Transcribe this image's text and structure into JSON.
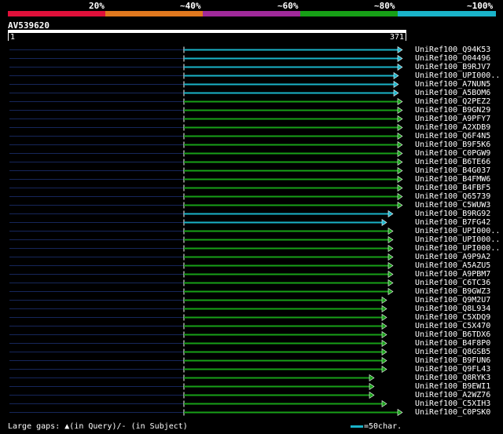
{
  "scale": {
    "labels": [
      "20%",
      "~40%",
      "~60%",
      "~80%",
      "~100%"
    ],
    "colors": [
      "#e0103a",
      "#e0781e",
      "#a02a9a",
      "#17a017",
      "#1ab3c9"
    ]
  },
  "query": {
    "name": "AV539620",
    "start": "1",
    "end": "371"
  },
  "hits": [
    {
      "label": "UniRef100_Q94K53",
      "color": "#1ab3c9",
      "end": 512
    },
    {
      "label": "UniRef100_O04496",
      "color": "#1ab3c9",
      "end": 512
    },
    {
      "label": "UniRef100_B9RJV7",
      "color": "#1ab3c9",
      "end": 512
    },
    {
      "label": "UniRef100_UPI000..",
      "color": "#1ab3c9",
      "end": 507
    },
    {
      "label": "UniRef100_A7NUN5",
      "color": "#1ab3c9",
      "end": 507
    },
    {
      "label": "UniRef100_A5BOM6",
      "color": "#1ab3c9",
      "end": 507
    },
    {
      "label": "UniRef100_Q2PEZ2",
      "color": "#17a017",
      "end": 512
    },
    {
      "label": "UniRef100_B9GN29",
      "color": "#17a017",
      "end": 512
    },
    {
      "label": "UniRef100_A9PFY7",
      "color": "#17a017",
      "end": 512
    },
    {
      "label": "UniRef100_A2XDB9",
      "color": "#17a017",
      "end": 512
    },
    {
      "label": "UniRef100_Q6F4N5",
      "color": "#17a017",
      "end": 512
    },
    {
      "label": "UniRef100_B9F5K6",
      "color": "#17a017",
      "end": 512
    },
    {
      "label": "UniRef100_C0PGW9",
      "color": "#17a017",
      "end": 512
    },
    {
      "label": "UniRef100_B6TE66",
      "color": "#17a017",
      "end": 512
    },
    {
      "label": "UniRef100_B4G037",
      "color": "#17a017",
      "end": 512
    },
    {
      "label": "UniRef100_B4FMW6",
      "color": "#17a017",
      "end": 512
    },
    {
      "label": "UniRef100_B4FBF5",
      "color": "#17a017",
      "end": 512
    },
    {
      "label": "UniRef100_Q65739",
      "color": "#17a017",
      "end": 512
    },
    {
      "label": "UniRef100_C5WUW3",
      "color": "#17a017",
      "end": 512
    },
    {
      "label": "UniRef100_B9RG92",
      "color": "#1ab3c9",
      "end": 500
    },
    {
      "label": "UniRef100_B7FG42",
      "color": "#1ab3c9",
      "end": 492
    },
    {
      "label": "UniRef100_UPI000..",
      "color": "#17a017",
      "end": 500
    },
    {
      "label": "UniRef100_UPI000..",
      "color": "#17a017",
      "end": 500
    },
    {
      "label": "UniRef100_UPI000..",
      "color": "#17a017",
      "end": 500
    },
    {
      "label": "UniRef100_A9P9A2",
      "color": "#17a017",
      "end": 500
    },
    {
      "label": "UniRef100_A5AZU5",
      "color": "#17a017",
      "end": 500
    },
    {
      "label": "UniRef100_A9PBM7",
      "color": "#17a017",
      "end": 500
    },
    {
      "label": "UniRef100_C6TC36",
      "color": "#17a017",
      "end": 500
    },
    {
      "label": "UniRef100_B9GWZ3",
      "color": "#17a017",
      "end": 500
    },
    {
      "label": "UniRef100_Q9M2U7",
      "color": "#17a017",
      "end": 492
    },
    {
      "label": "UniRef100_Q8L934",
      "color": "#17a017",
      "end": 492
    },
    {
      "label": "UniRef100_C5XDQ9",
      "color": "#17a017",
      "end": 492
    },
    {
      "label": "UniRef100_C5X470",
      "color": "#17a017",
      "end": 492
    },
    {
      "label": "UniRef100_B6TDX6",
      "color": "#17a017",
      "end": 492
    },
    {
      "label": "UniRef100_B4F8P0",
      "color": "#17a017",
      "end": 492
    },
    {
      "label": "UniRef100_Q8GSB5",
      "color": "#17a017",
      "end": 492
    },
    {
      "label": "UniRef100_B9FUN6",
      "color": "#17a017",
      "end": 492
    },
    {
      "label": "UniRef100_Q9FL43",
      "color": "#17a017",
      "end": 492
    },
    {
      "label": "UniRef100_Q8RYK3",
      "color": "#17a017",
      "end": 476
    },
    {
      "label": "UniRef100_B9EWI1",
      "color": "#17a017",
      "end": 476
    },
    {
      "label": "UniRef100_A2WZ76",
      "color": "#17a017",
      "end": 476
    },
    {
      "label": "UniRef100_C5XIH3",
      "color": "#17a017",
      "end": 492
    },
    {
      "label": "UniRef100_C0PSK0",
      "color": "#17a017",
      "end": 512
    }
  ],
  "footer": {
    "gaps_prefix": "Large gaps:",
    "gaps_query": "(in Query)/",
    "gaps_subject": "- (in Subject)",
    "legend_text": "=50char."
  }
}
